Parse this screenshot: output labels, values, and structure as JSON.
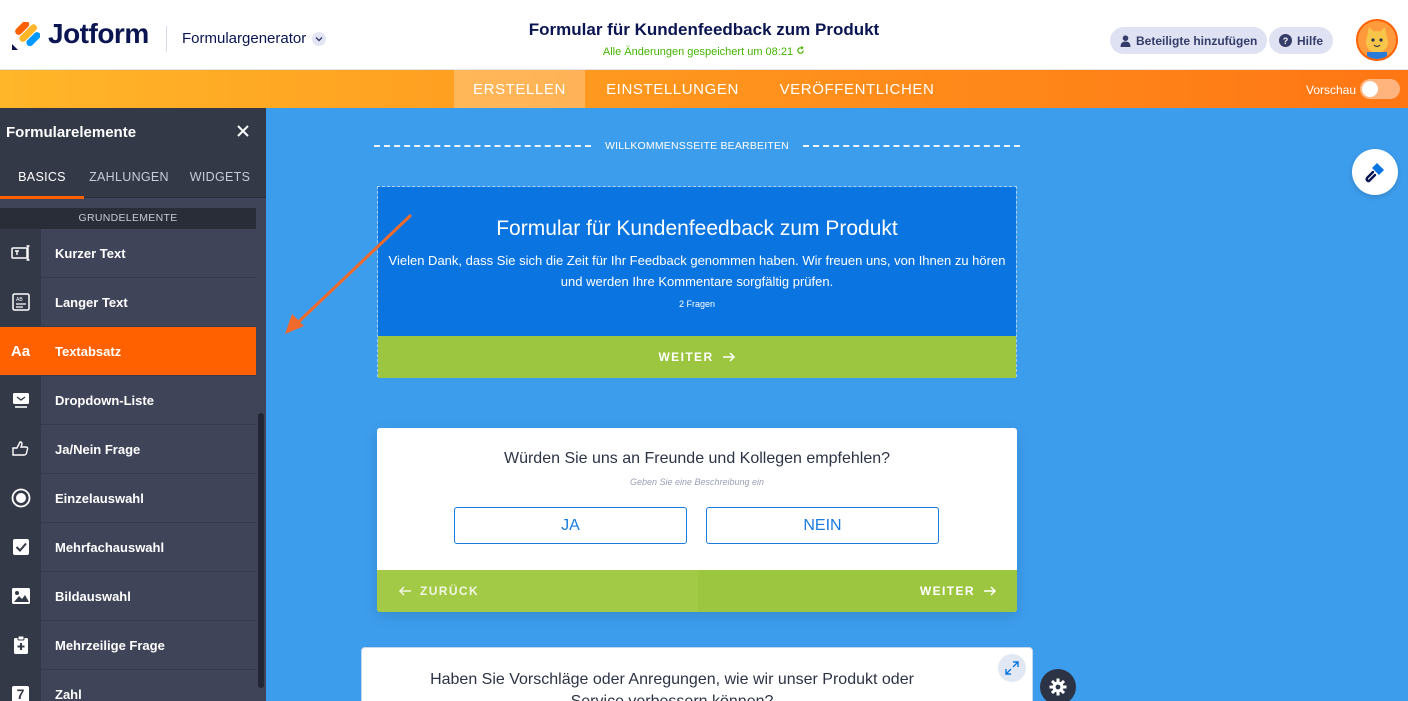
{
  "app": {
    "brand": "Jotform",
    "builder_label": "Formulargenerator",
    "form_title": "Formular für Kundenfeedback zum Produkt",
    "saved_status": "Alle Änderungen gespeichert um 08:21",
    "add_participants": "Beteiligte hinzufügen",
    "help": "Hilfe"
  },
  "nav": {
    "tabs": [
      {
        "label": "ERSTELLEN",
        "active": true
      },
      {
        "label": "EINSTELLUNGEN",
        "active": false
      },
      {
        "label": "VERÖFFENTLICHEN",
        "active": false
      }
    ],
    "preview_label": "Vorschau"
  },
  "sidebar": {
    "title": "Formularelemente",
    "tabs": [
      {
        "label": "BASICS",
        "active": true
      },
      {
        "label": "ZAHLUNGEN",
        "active": false
      },
      {
        "label": "WIDGETS",
        "active": false
      }
    ],
    "group_label": "GRUNDELEMENTE",
    "items": [
      {
        "label": "Kurzer Text",
        "icon": "short-text-icon"
      },
      {
        "label": "Langer Text",
        "icon": "long-text-icon"
      },
      {
        "label": "Textabsatz",
        "icon": "paragraph-icon",
        "icon_text": "Aa",
        "active": true
      },
      {
        "label": "Dropdown-Liste",
        "icon": "dropdown-icon"
      },
      {
        "label": "Ja/Nein Frage",
        "icon": "yes-no-icon"
      },
      {
        "label": "Einzelauswahl",
        "icon": "radio-icon"
      },
      {
        "label": "Mehrfachauswahl",
        "icon": "checkbox-icon"
      },
      {
        "label": "Bildauswahl",
        "icon": "image-choice-icon"
      },
      {
        "label": "Mehrzeilige Frage",
        "icon": "multi-line-icon"
      },
      {
        "label": "Zahl",
        "icon": "number-icon",
        "icon_text": "7"
      }
    ]
  },
  "canvas": {
    "welcome_edit_label": "WILLKOMMENSSEITE BEARBEITEN",
    "welcome": {
      "title": "Formular für Kundenfeedback zum Produkt",
      "text": "Vielen Dank, dass Sie sich die Zeit für Ihr Feedback genommen haben. Wir freuen uns, von Ihnen zu hören und werden Ihre Kommentare sorgfältig prüfen.",
      "count": "2 Fragen",
      "next_label": "WEITER"
    },
    "question1": {
      "title": "Würden Sie uns an Freunde und Kollegen empfehlen?",
      "description_placeholder": "Geben Sie eine Beschreibung ein",
      "yes": "JA",
      "no": "NEIN",
      "back_label": "ZURÜCK",
      "next_label": "WEITER"
    },
    "question2": {
      "title": "Haben Sie Vorschläge oder Anregungen, wie wir unser Produkt oder Service verbessern können?"
    }
  },
  "colors": {
    "brand_orange": "#ff6100",
    "canvas_blue": "#3d9ded",
    "welcome_blue": "#0a75e0",
    "button_green": "#9cc63f",
    "sidebar_dark": "#3f4459"
  }
}
